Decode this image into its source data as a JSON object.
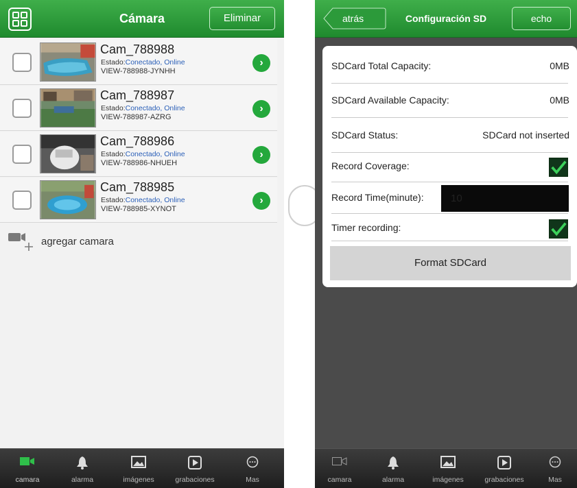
{
  "left": {
    "header": {
      "title": "Cámara",
      "delete_label": "Eliminar"
    },
    "cameras": [
      {
        "name": "Cam_788988",
        "status_prefix": "Estado:",
        "status": "Conectado, Online",
        "id": "VIEW-788988-JYNHH",
        "thumb": "pool-camera-thumbnail"
      },
      {
        "name": "Cam_788987",
        "status_prefix": "Estado:",
        "status": "Conectado, Online",
        "id": "VIEW-788987-AZRG",
        "thumb": "street-camera-thumbnail"
      },
      {
        "name": "Cam_788986",
        "status_prefix": "Estado:",
        "status": "Conectado, Online",
        "id": "VIEW-788986-NHUEH",
        "thumb": "indoor-camera-thumbnail"
      },
      {
        "name": "Cam_788985",
        "status_prefix": "Estado:",
        "status": "Conectado, Online",
        "id": "VIEW-788985-XYNOT",
        "thumb": "pool-camera-thumbnail"
      }
    ],
    "add_camera_label": "agregar camara",
    "tabs": [
      {
        "label": "camara",
        "icon": "camera-icon"
      },
      {
        "label": "alarma",
        "icon": "bell-icon"
      },
      {
        "label": "imágenes",
        "icon": "image-icon"
      },
      {
        "label": "grabaciones",
        "icon": "play-icon"
      },
      {
        "label": "Mas",
        "icon": "more-icon"
      }
    ]
  },
  "right": {
    "header": {
      "back_label": "atrás",
      "title": "Configuración SD",
      "done_label": "echo"
    },
    "settings": {
      "total_capacity_label": "SDCard Total Capacity:",
      "total_capacity_value": "0MB",
      "available_capacity_label": "SDCard Available Capacity:",
      "available_capacity_value": "0MB",
      "status_label": "SDCard Status:",
      "status_value": "SDCard not inserted",
      "record_coverage_label": "Record Coverage:",
      "record_coverage_checked": true,
      "record_time_label": "Record Time(minute):",
      "record_time_value": "10",
      "timer_recording_label": "Timer recording:",
      "timer_recording_checked": true
    },
    "format_label": "Format SDCard",
    "tabs": [
      {
        "label": "camara",
        "icon": "camera-icon"
      },
      {
        "label": "alarma",
        "icon": "bell-icon"
      },
      {
        "label": "imágenes",
        "icon": "image-icon"
      },
      {
        "label": "grabaciones",
        "icon": "play-icon"
      },
      {
        "label": "Mas",
        "icon": "more-icon"
      }
    ]
  },
  "colors": {
    "accent": "#24a83c",
    "header_green": "#2e9c3c",
    "status_blue": "#2a5fb8",
    "dark_bg": "#4b4b4b"
  }
}
